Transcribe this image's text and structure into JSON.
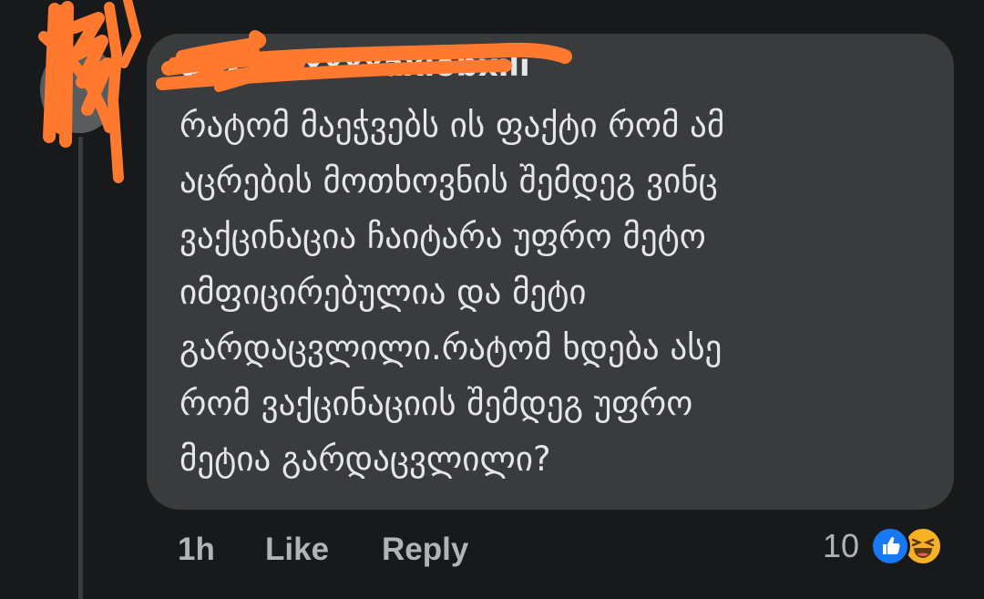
{
  "comment": {
    "author": "ahxxxxxxxxaxiobxili",
    "lines": [
      "რატომ მაეჭვებს ის ფაქტი რომ ამ",
      "აცრების მოთხოვნის შემდეგ ვინც",
      "ვაქცინაცია ჩაიტარა უფრო მეტო",
      "იმფიცირებულია და მეტი",
      "გარდაცვლილი.რატომ ხდება ასე",
      "რომ ვაქცინაციის შემდეგ უფრო",
      "მეტია გარდაცვლილი?"
    ],
    "time": "1h",
    "like_label": "Like",
    "reply_label": "Reply",
    "reaction_count": "10",
    "reactions": [
      "like-icon",
      "haha-icon"
    ]
  },
  "colors": {
    "background": "#18191a",
    "bubble": "#3a3b3c",
    "text": "#e4e6eb",
    "meta": "#b0b3b8",
    "scribble": "#ff7a2f",
    "like": "#1877f2",
    "haha": "#f7b125"
  }
}
